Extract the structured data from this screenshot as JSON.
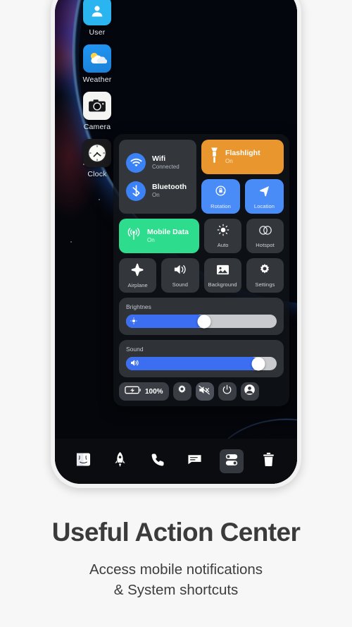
{
  "caption": {
    "title": "Useful Action Center",
    "subtitle_line1": "Access mobile notifications",
    "subtitle_line2": "& System shortcuts"
  },
  "desktop": {
    "apps": [
      {
        "label": "User",
        "icon": "user-icon"
      },
      {
        "label": "Weather",
        "icon": "weather-icon"
      },
      {
        "label": "Camera",
        "icon": "camera-icon"
      },
      {
        "label": "Clock",
        "icon": "clock-icon"
      }
    ]
  },
  "control_center": {
    "connectivity": [
      {
        "title": "Wifi",
        "status": "Connected",
        "icon": "wifi-icon",
        "active": true
      },
      {
        "title": "Bluetooth",
        "status": "On",
        "icon": "bluetooth-icon",
        "active": true
      }
    ],
    "flashlight": {
      "title": "Flashlight",
      "status": "On",
      "icon": "flashlight-icon",
      "color": "#e9962f"
    },
    "rotation": {
      "label": "Rotation",
      "icon": "rotation-lock-icon",
      "color": "#4a8cf7"
    },
    "location": {
      "label": "Location",
      "icon": "location-arrow-icon",
      "color": "#4a8cf7"
    },
    "mobile_data": {
      "title": "Mobile Data",
      "status": "On",
      "icon": "mobile-data-icon",
      "color": "#2ddc8c"
    },
    "auto": {
      "label": "Auto",
      "icon": "brightness-auto-icon"
    },
    "hotspot": {
      "label": "Hotspot",
      "icon": "hotspot-icon"
    },
    "airplane": {
      "label": "Airplane",
      "icon": "airplane-icon"
    },
    "sound_tile": {
      "label": "Sound",
      "icon": "speaker-icon"
    },
    "background": {
      "label": "Background",
      "icon": "image-icon"
    },
    "settings": {
      "label": "Settings",
      "icon": "gear-icon"
    },
    "brightness_slider": {
      "label": "Brightnes",
      "value": 52,
      "icon": "brightness-icon"
    },
    "sound_slider": {
      "label": "Sound",
      "value": 88,
      "icon": "volume-icon"
    },
    "actions": {
      "battery": {
        "label": "100%",
        "icon": "battery-charging-icon"
      },
      "settings_btn": {
        "icon": "gear-icon"
      },
      "mute_btn": {
        "icon": "sound-off-icon"
      },
      "power_btn": {
        "icon": "power-icon"
      },
      "account_btn": {
        "icon": "account-circle-icon"
      }
    }
  },
  "dock": {
    "items": [
      {
        "name": "finder",
        "icon": "finder-icon",
        "active": false
      },
      {
        "name": "launcher",
        "icon": "rocket-icon",
        "active": false
      },
      {
        "name": "phone",
        "icon": "phone-icon",
        "active": false
      },
      {
        "name": "messages",
        "icon": "message-icon",
        "active": false
      },
      {
        "name": "control",
        "icon": "toggles-icon",
        "active": true
      },
      {
        "name": "trash",
        "icon": "trash-icon",
        "active": false
      }
    ]
  },
  "colors": {
    "accent_blue": "#4a8cf7",
    "slider_blue": "#3b6ef0",
    "orange": "#e9962f",
    "green": "#2ddc8c",
    "panel_bg": "#33363b"
  }
}
